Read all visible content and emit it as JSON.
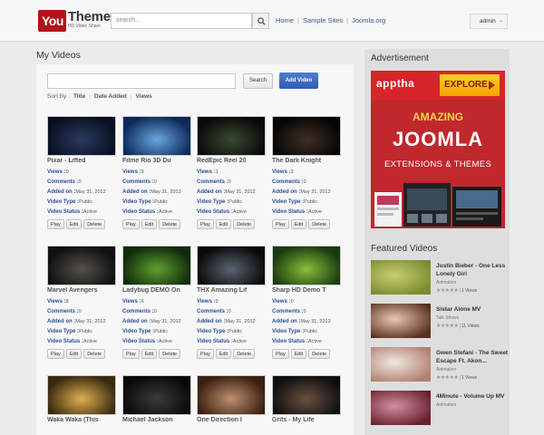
{
  "header": {
    "logo_you": "You",
    "logo_theme": "Theme",
    "logo_tagline": "HD Video Share",
    "search_placeholder": "search...",
    "nav": [
      "Home",
      "Sample Sites",
      "Joomla.org"
    ],
    "user_menu": "admin"
  },
  "main": {
    "title": "My Videos",
    "search_button": "Search",
    "add_button": "Add Video",
    "sort_label": "Sort By :",
    "sort_options": [
      "Title",
      "Date Added",
      "Views"
    ],
    "labels": {
      "views": "Views :",
      "comments": "Comments :",
      "added_on": "Added on :",
      "video_type": "Video Type :",
      "video_status": "Video Status :"
    },
    "actions": [
      "Play",
      "Edit",
      "Delete"
    ],
    "videos": [
      {
        "title": "Pixar - Lifted",
        "views": "0",
        "comments": "0",
        "added": "May 31, 2012",
        "type": "Public",
        "status": "Active",
        "colors": [
          "#0a1020",
          "#2a3b60"
        ]
      },
      {
        "title": "Filme Rio 3D Du",
        "views": "9",
        "comments": "0",
        "added": "May 31, 2012",
        "type": "Public",
        "status": "Active",
        "colors": [
          "#0d2a5a",
          "#6aa6e0"
        ]
      },
      {
        "title": "RedEpic Reel 20",
        "views": "1",
        "comments": "0",
        "added": "May 31, 2012",
        "type": "Public",
        "status": "Active",
        "colors": [
          "#0a0a0a",
          "#3a4a30"
        ]
      },
      {
        "title": "The Dark Knight",
        "views": "2",
        "comments": "0",
        "added": "May 31, 2012",
        "type": "Public",
        "status": "Active",
        "colors": [
          "#050505",
          "#403025"
        ]
      },
      {
        "title": "Marvel Avengers",
        "views": "8",
        "comments": "0",
        "added": "May 31, 2012",
        "type": "Public",
        "status": "Active",
        "colors": [
          "#101010",
          "#55504a"
        ]
      },
      {
        "title": "Ladybug DEMO On",
        "views": "6",
        "comments": "0",
        "added": "May 31, 2012",
        "type": "Public",
        "status": "Active",
        "colors": [
          "#0f2a0a",
          "#5fa030"
        ]
      },
      {
        "title": "THX Amazing Lif",
        "views": "0",
        "comments": "0",
        "added": "May 31, 2012",
        "type": "Public",
        "status": "Active",
        "colors": [
          "#0a0a0a",
          "#5a6470"
        ]
      },
      {
        "title": "Sharp HD Demo T",
        "views": "0",
        "comments": "0",
        "added": "May 31, 2012",
        "type": "Public",
        "status": "Active",
        "colors": [
          "#1a3a10",
          "#8abf3a"
        ]
      },
      {
        "title": "Waka Waka (This",
        "views": "",
        "comments": "",
        "added": "",
        "type": "",
        "status": "",
        "colors": [
          "#3a2a10",
          "#e0b050"
        ]
      },
      {
        "title": "Michael Jackson",
        "views": "",
        "comments": "",
        "added": "",
        "type": "",
        "status": "",
        "colors": [
          "#0a0a0a",
          "#3a3a3a"
        ]
      },
      {
        "title": "One Direction I",
        "views": "",
        "comments": "",
        "added": "",
        "type": "",
        "status": "",
        "colors": [
          "#3a2010",
          "#c09070"
        ]
      },
      {
        "title": "Grits - My Life",
        "views": "",
        "comments": "",
        "added": "",
        "type": "",
        "status": "",
        "colors": [
          "#101010",
          "#6a5040"
        ]
      }
    ]
  },
  "sidebar": {
    "ad_title": "Advertisement",
    "ad": {
      "brand": "apptha",
      "cta": "EXPLORE",
      "line1": "AMAZING",
      "line2": "JOOMLA",
      "line3": "EXTENSIONS & THEMES"
    },
    "featured_title": "Featured Videos",
    "featured": [
      {
        "title": "Justin Bieber - One Less Lonely Girl",
        "category": "Animation",
        "stars": "★★★★★",
        "views": "1 Views",
        "colors": [
          "#c8d070",
          "#7a8a30"
        ]
      },
      {
        "title": "Sistar Alone MV",
        "category": "Talk Shows",
        "stars": "★★★★★",
        "views": "11 Views",
        "colors": [
          "#e8c8b0",
          "#5a3020"
        ]
      },
      {
        "title": "Gwen Stefani - The Sweet Escape Ft. Akon...",
        "category": "Animation",
        "stars": "★★★★★",
        "views": "1 Views",
        "colors": [
          "#f0e8e0",
          "#b08070"
        ]
      },
      {
        "title": "4Minute - Volume Up MV",
        "category": "Animation",
        "stars": "",
        "views": "",
        "colors": [
          "#d090a0",
          "#6a2030"
        ]
      }
    ]
  }
}
